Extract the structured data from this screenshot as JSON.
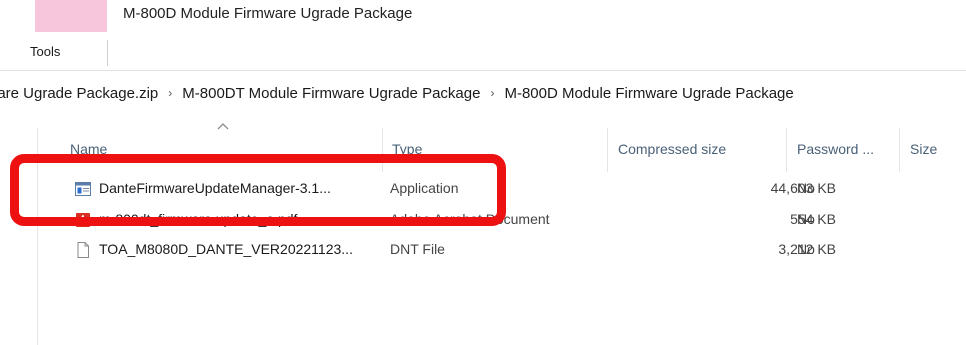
{
  "window": {
    "title": "M-800D Module Firmware Ugrade Package",
    "accent_color": "#f7c6dc"
  },
  "ribbon": {
    "tab_label": "Tools"
  },
  "address_bar": {
    "crumbs": [
      "mware Ugrade Package.zip",
      "M-800DT Module Firmware Ugrade Package",
      "M-800D Module Firmware Ugrade Package"
    ],
    "separator": "›"
  },
  "columns": {
    "name": "Name",
    "type": "Type",
    "compressed_size": "Compressed size",
    "password": "Password ...",
    "size": "Size"
  },
  "files": [
    {
      "name": "DanteFirmwareUpdateManager-3.1...",
      "type": "Application",
      "compressed_size": "44,603 KB",
      "password": "No",
      "icon": "application-icon"
    },
    {
      "name": "m-800dt_firmware update_e.pdf",
      "type": "Adobe Acrobat Document",
      "compressed_size": "554 KB",
      "password": "No",
      "icon": "pdf-icon"
    },
    {
      "name": "TOA_M8080D_DANTE_VER20221123...",
      "type": "DNT File",
      "compressed_size": "3,212 KB",
      "password": "No",
      "icon": "document-icon"
    }
  ],
  "highlight_color": "#ee1111"
}
